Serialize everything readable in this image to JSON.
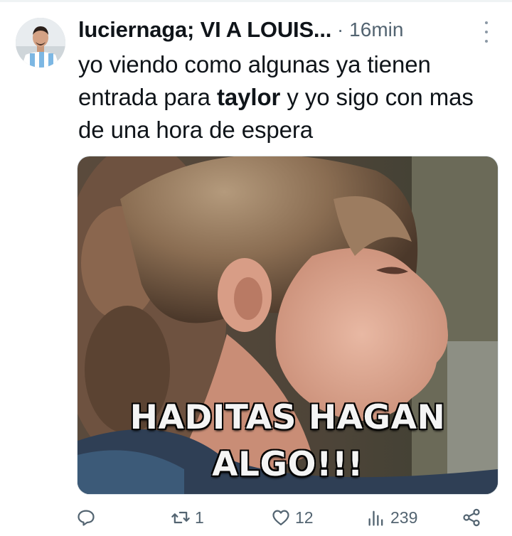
{
  "tweet": {
    "author": {
      "display_name": "luciernaga; VI A LOUIS...",
      "avatar_icon": "user-avatar"
    },
    "separator": "·",
    "timestamp": "16min",
    "text": {
      "before": "yo viendo como algunas ya tienen entrada para ",
      "bold": "taylor",
      "after": " y yo sigo con mas de una hora de espera"
    },
    "media": {
      "caption_line1": "HADITAS HAGAN",
      "caption_line2": "ALGO!!!"
    },
    "actions": {
      "reply_count": "",
      "retweet_count": "1",
      "like_count": "12",
      "view_count": "239"
    }
  },
  "colors": {
    "text_primary": "#0f1419",
    "text_secondary": "#536471",
    "caption": "#f4f4f4"
  }
}
